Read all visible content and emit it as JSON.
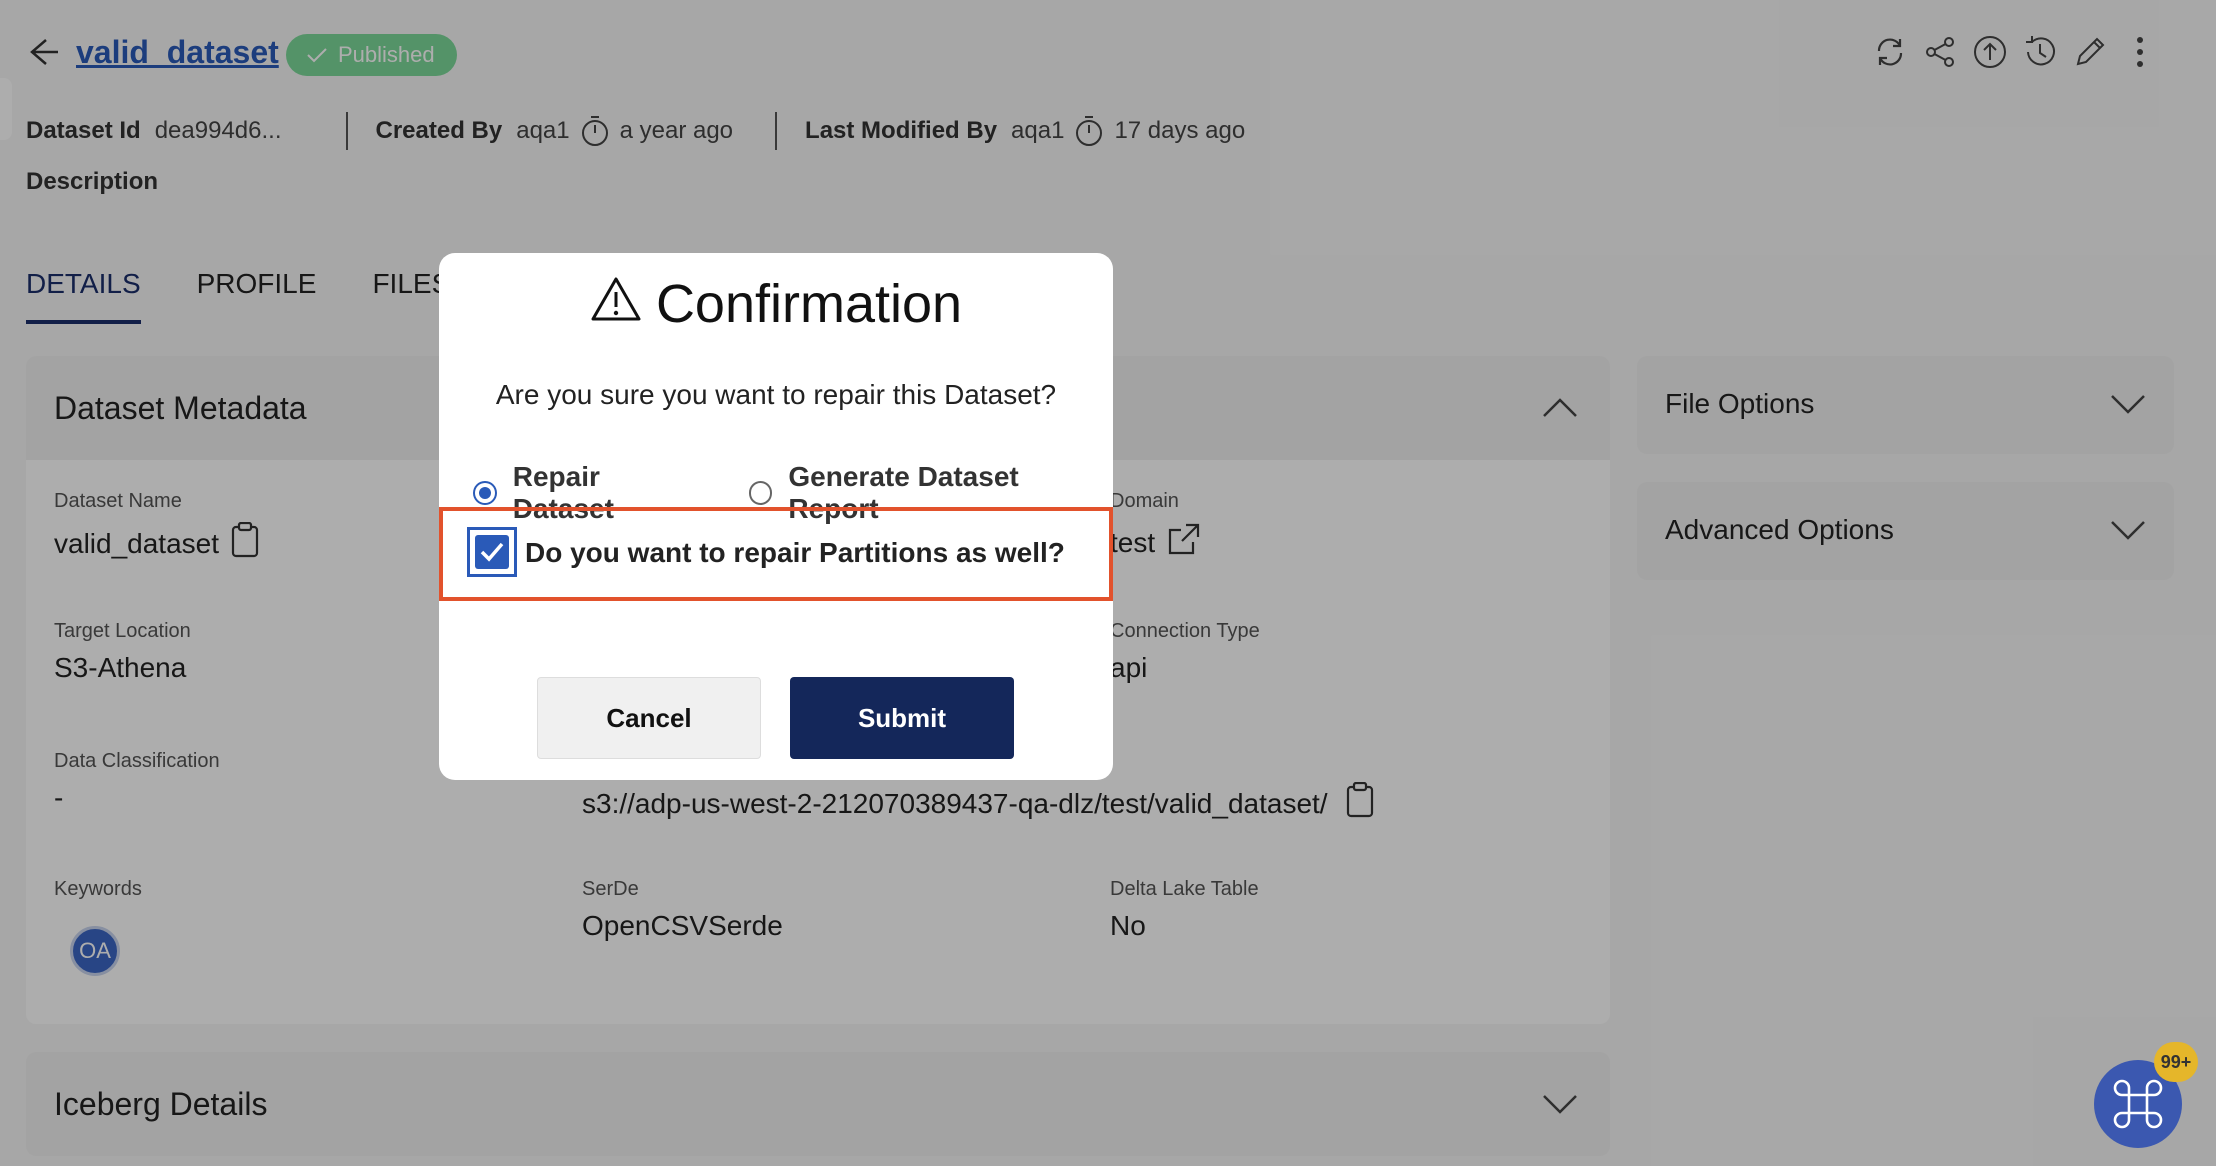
{
  "header": {
    "dataset_name": "valid_dataset",
    "status_badge": "Published",
    "dataset_id_label": "Dataset Id",
    "dataset_id_value": "dea994d6...",
    "created_by_label": "Created By",
    "created_by_value": "aqa1",
    "created_ago": "a year ago",
    "modified_by_label": "Last Modified By",
    "modified_by_value": "aqa1",
    "modified_ago": "17 days ago",
    "description_label": "Description",
    "toolbar_icons": [
      "refresh-icon",
      "share-icon",
      "upload-icon",
      "history-icon",
      "edit-icon",
      "more-vertical-icon"
    ]
  },
  "tabs": [
    {
      "label": "DETAILS",
      "active": true
    },
    {
      "label": "PROFILE",
      "active": false
    },
    {
      "label": "FILES",
      "active": false
    }
  ],
  "metadata_card": {
    "title": "Dataset Metadata",
    "fields": {
      "dataset_name_label": "Dataset Name",
      "dataset_name_value": "valid_dataset",
      "domain_label": "Domain",
      "domain_value": "test",
      "target_location_label": "Target Location",
      "target_location_value": "S3-Athena",
      "connection_type_label": "Connection Type",
      "connection_type_value": "api",
      "data_classification_label": "Data Classification",
      "data_classification_value": "-",
      "s3_path_value": "s3://adp-us-west-2-212070389437-qa-dlz/test/valid_dataset/",
      "keywords_label": "Keywords",
      "keywords_avatar": "OA",
      "serde_label": "SerDe",
      "serde_value": "OpenCSVSerde",
      "delta_lake_label": "Delta Lake Table",
      "delta_lake_value": "No"
    }
  },
  "iceberg_card": {
    "title": "Iceberg Details"
  },
  "side_cards": {
    "file_options": "File Options",
    "advanced_options": "Advanced Options"
  },
  "modal": {
    "title": "Confirmation",
    "message": "Are you sure you want to repair this Dataset?",
    "radio_repair": "Repair Dataset",
    "radio_report": "Generate Dataset Report",
    "selected": "Repair Dataset",
    "checkbox_label": "Do you want to repair Partitions as well?",
    "checkbox_checked": true,
    "cancel_label": "Cancel",
    "submit_label": "Submit"
  },
  "fab": {
    "badge": "99+"
  },
  "colors": {
    "accent": "#2a5ab8",
    "navy": "#14275a",
    "published": "#7dd99a",
    "highlight": "#e2522c"
  }
}
